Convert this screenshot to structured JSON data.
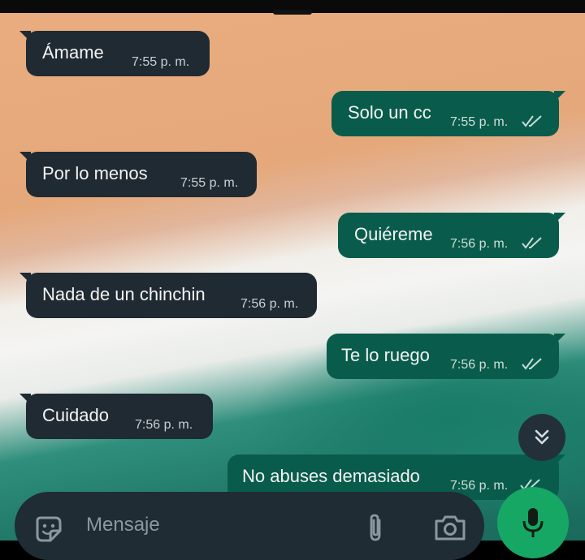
{
  "messages": [
    {
      "text": "Ámame",
      "time": "7:55 p. m.",
      "direction": "in"
    },
    {
      "text": "Solo un cc",
      "time": "7:55 p. m.",
      "direction": "out",
      "status": "read"
    },
    {
      "text": "Por lo menos",
      "time": "7:55 p. m.",
      "direction": "in"
    },
    {
      "text": "Quiéreme",
      "time": "7:56 p. m.",
      "direction": "out",
      "status": "read"
    },
    {
      "text": "Nada de un chinchin",
      "time": "7:56 p. m.",
      "direction": "in"
    },
    {
      "text": "Te lo ruego",
      "time": "7:56 p. m.",
      "direction": "out",
      "status": "read"
    },
    {
      "text": "Cuidado",
      "time": "7:56 p. m.",
      "direction": "in"
    },
    {
      "text": "No abuses demasiado",
      "time": "7:56 p. m.",
      "direction": "out",
      "status": "read"
    }
  ],
  "composer": {
    "placeholder": "Mensaje",
    "emoji_icon": "sticker-icon",
    "attach_icon": "paperclip-icon",
    "camera_icon": "camera-icon",
    "send_icon": "mic-icon"
  },
  "scroll_button": {
    "icon": "double-chevron-down-icon"
  },
  "colors": {
    "incoming_bubble": "#202a33",
    "outgoing_bubble": "#095c4c",
    "mic_button": "#16a765",
    "read_ticks": "#c9dbd6"
  }
}
